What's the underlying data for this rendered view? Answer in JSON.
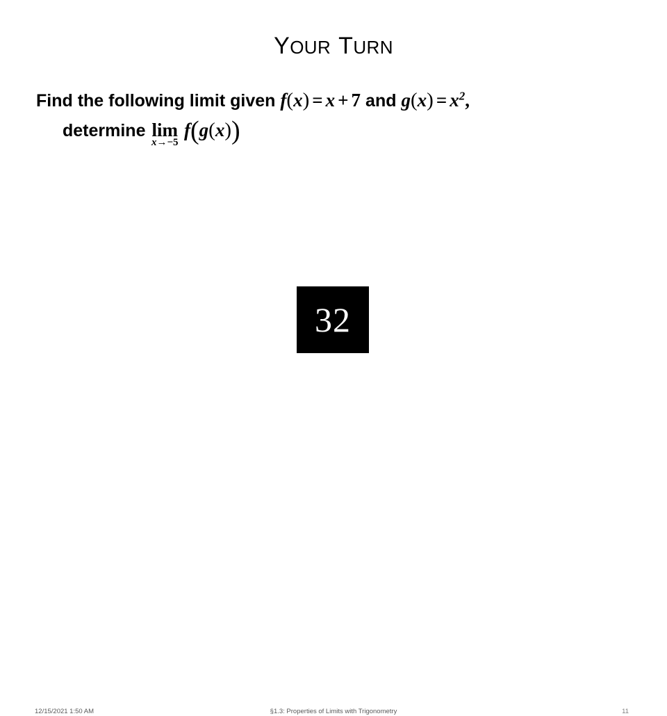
{
  "slide": {
    "title": {
      "words": [
        {
          "first": "Y",
          "rest": "OUR"
        },
        {
          "first": "T",
          "rest": "URN"
        }
      ],
      "plain_text": "YOUR TURN"
    },
    "background_color": "#FFFFFF",
    "body": {
      "line1": {
        "plain_text": "Find the following limit given f(x) = x + 7 and g(x) = x²,",
        "prefix_text": "Find the following limit given",
        "f_name": "f",
        "f_open": "(",
        "f_arg": "x",
        "f_close": ")",
        "equals": "=",
        "rhs_var": "x",
        "plus": "+",
        "rhs_num": "7",
        "conjunction": "and",
        "g_name": "g",
        "g_open": "(",
        "g_arg": "x",
        "g_close": ")",
        "g_equals": "=",
        "g_rhs_var": "x",
        "g_rhs_exponent": "2",
        "trailing_comma": ","
      },
      "line2": {
        "plain_text": "determine lim x→−5 f(g(x))",
        "prefix_text": "determine",
        "limit_operator": "lim",
        "limit_sub_var": "x",
        "limit_sub_arrow_value": "→−5",
        "outer_fn": "f",
        "outer_open": "(",
        "inner_fn": "g",
        "inner_open": "(",
        "inner_arg": "x",
        "inner_close": ")",
        "outer_close": ")"
      }
    },
    "media": {
      "label": "32",
      "background_color": "#000000",
      "text_color": "#FFFFFF"
    },
    "footer": {
      "date": "12/15/2021 1:50 AM",
      "center": "§1.3: Properties of Limits with Trigonometry",
      "page_number": "11",
      "text_color": "#595959",
      "page_color": "#808080"
    }
  }
}
